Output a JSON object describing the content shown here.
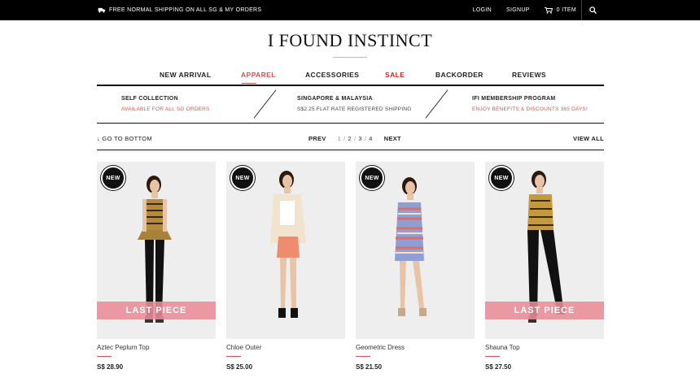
{
  "topbar": {
    "shipping_text": "FREE NORMAL SHIPPING ON ALL SG & MY ORDERS",
    "login": "LOGIN",
    "signup": "SIGNUP",
    "cart": "0 ITEM"
  },
  "brand": {
    "logo": "I FOUND INSTINCT"
  },
  "nav": {
    "items": [
      "NEW ARRIVAL",
      "APPAREL",
      "ACCESSORIES",
      "SALE",
      "BACKORDER",
      "REVIEWS"
    ]
  },
  "info": [
    {
      "title": "SELF COLLECTION",
      "subtitle": "AVAILABLE FOR ALL SG ORDERS"
    },
    {
      "title": "SINGAPORE & MALAYSIA",
      "subtitle": "S$2.25 FLAT RATE REGISTERED SHIPPING"
    },
    {
      "title": "IFI MEMBERSHIP PROGRAM",
      "subtitle": "ENJOY BENEFITS & DISCOUNTS 365 DAYS!"
    }
  ],
  "pager": {
    "goto": "↓ GO TO BOTTOM",
    "prev": "PREV",
    "pages": [
      "1",
      "2",
      "3",
      "4"
    ],
    "next": "NEXT",
    "view_all": "VIEW ALL"
  },
  "products": [
    {
      "badge": "NEW",
      "overlay": "LAST PIECE",
      "name": "Aztec Peplum Top",
      "price": "S$ 28.90"
    },
    {
      "badge": "NEW",
      "overlay": "",
      "name": "Chloe Outer",
      "price": "S$ 25.00"
    },
    {
      "badge": "NEW",
      "overlay": "",
      "name": "Geometric Dress",
      "price": "S$ 21.50"
    },
    {
      "badge": "NEW",
      "overlay": "LAST PIECE",
      "name": "Shauna Top",
      "price": "S$ 27.50"
    }
  ],
  "colors": {
    "accent": "#d9534f",
    "sale": "#d9231d",
    "topbar": "#000000"
  }
}
